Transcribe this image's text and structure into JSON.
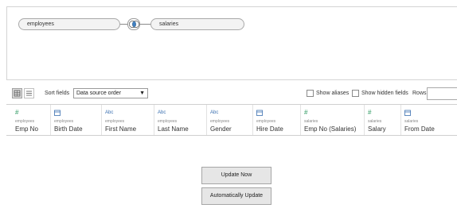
{
  "join": {
    "left_table": "employees",
    "right_table": "salaries",
    "join_type_icon": "inner-join-icon"
  },
  "toolbar": {
    "sort_label": "Sort fields",
    "sort_value": "Data source order",
    "show_aliases": "Show aliases",
    "show_hidden": "Show hidden fields",
    "rows_label": "Rows",
    "rows_value": ""
  },
  "columns": [
    {
      "type_icon": "#",
      "type": "number",
      "source": "employees",
      "name": "Emp No"
    },
    {
      "type_icon": "date-icon",
      "type": "date",
      "source": "employees",
      "name": "Birth Date"
    },
    {
      "type_icon": "Abc",
      "type": "string",
      "source": "employees",
      "name": "First Name"
    },
    {
      "type_icon": "Abc",
      "type": "string",
      "source": "employees",
      "name": "Last Name"
    },
    {
      "type_icon": "Abc",
      "type": "string",
      "source": "employees",
      "name": "Gender"
    },
    {
      "type_icon": "date-icon",
      "type": "date",
      "source": "employees",
      "name": "Hire Date"
    },
    {
      "type_icon": "#",
      "type": "number",
      "source": "salaries",
      "name": "Emp No (Salaries)"
    },
    {
      "type_icon": "#",
      "type": "number",
      "source": "salaries",
      "name": "Salary"
    },
    {
      "type_icon": "date-icon",
      "type": "date",
      "source": "salaries",
      "name": "From Date"
    }
  ],
  "buttons": {
    "update_now": "Update Now",
    "auto_update": "Automatically Update"
  },
  "colors": {
    "number_icon": "#2e9a62",
    "text_icon": "#3a6fb0",
    "button_bg": "#e6e6e6"
  }
}
